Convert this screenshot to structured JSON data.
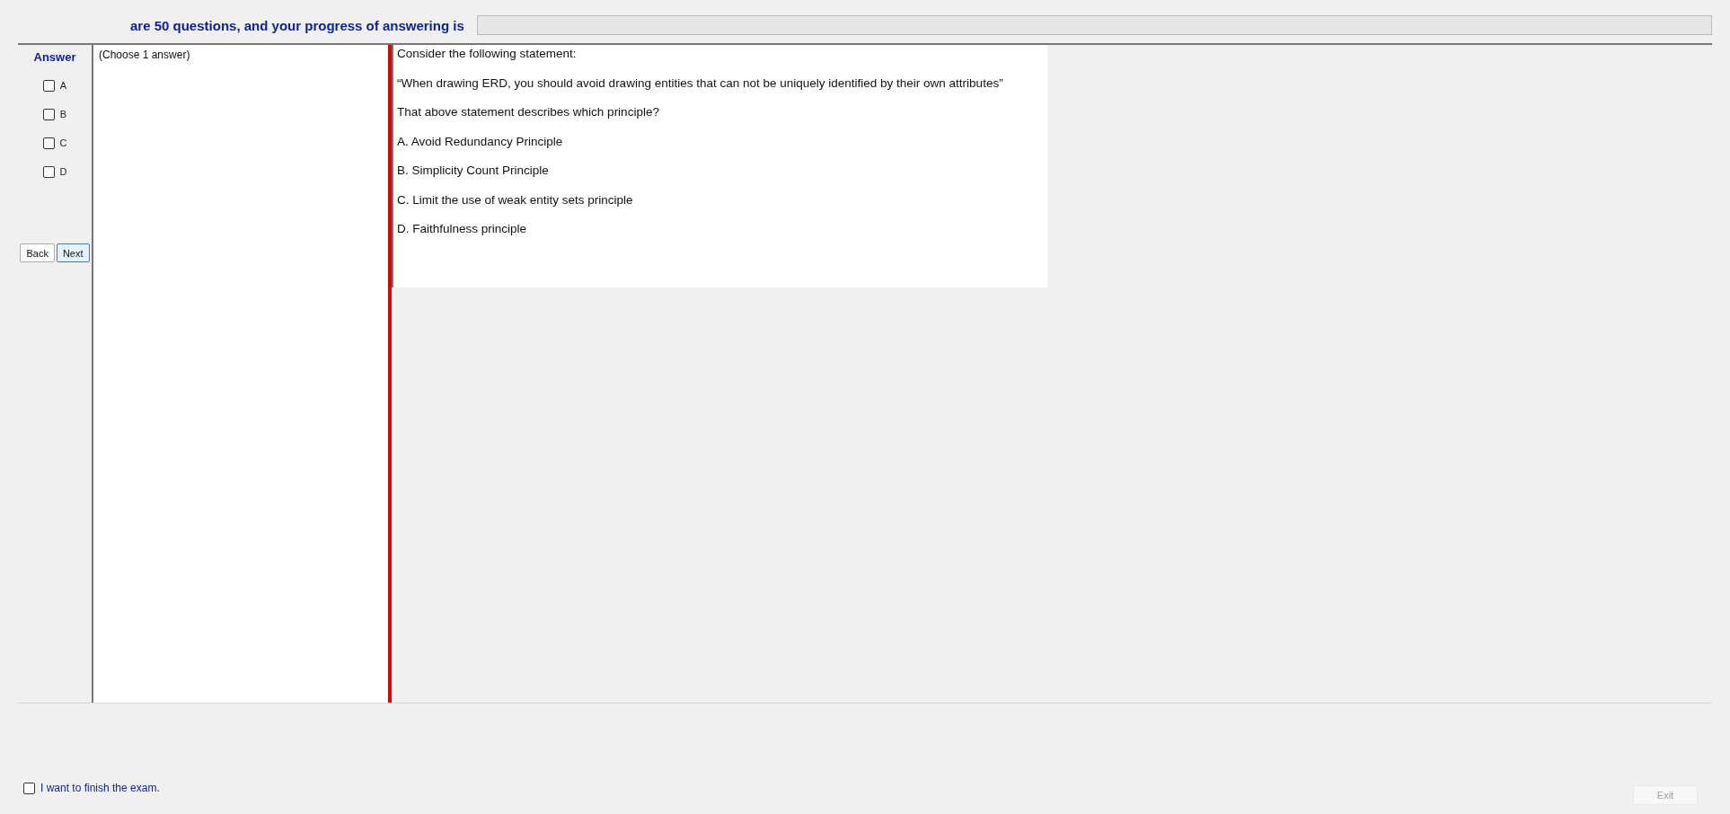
{
  "header": {
    "text": "are 50 questions, and your progress of answering is",
    "progress": {
      "level": 0
    }
  },
  "answer_panel": {
    "title": "Answer",
    "options": [
      {
        "label": "A",
        "checked": false
      },
      {
        "label": "B",
        "checked": false
      },
      {
        "label": "C",
        "checked": false
      },
      {
        "label": "D",
        "checked": false
      }
    ],
    "buttons": [
      {
        "label": "Back",
        "selected": false
      },
      {
        "label": "Next",
        "selected": true
      }
    ]
  },
  "instruction": "(Choose 1 answer)",
  "question": {
    "paragraphs": [
      "Consider the following statement:",
      "“When drawing ERD, you should avoid drawing entities that can not be uniquely identified by their own attributes”",
      "That above statement describes which principle?",
      "A.  Avoid Redundancy Principle",
      "B.  Simplicity Count Principle",
      "C.  Limit the use of weak entity sets principle",
      "D.  Faithfulness principle"
    ]
  },
  "finish": {
    "label": "I want to finish the exam.",
    "checked": false
  },
  "exit_button": {
    "label": "Exit",
    "disabled": true
  }
}
